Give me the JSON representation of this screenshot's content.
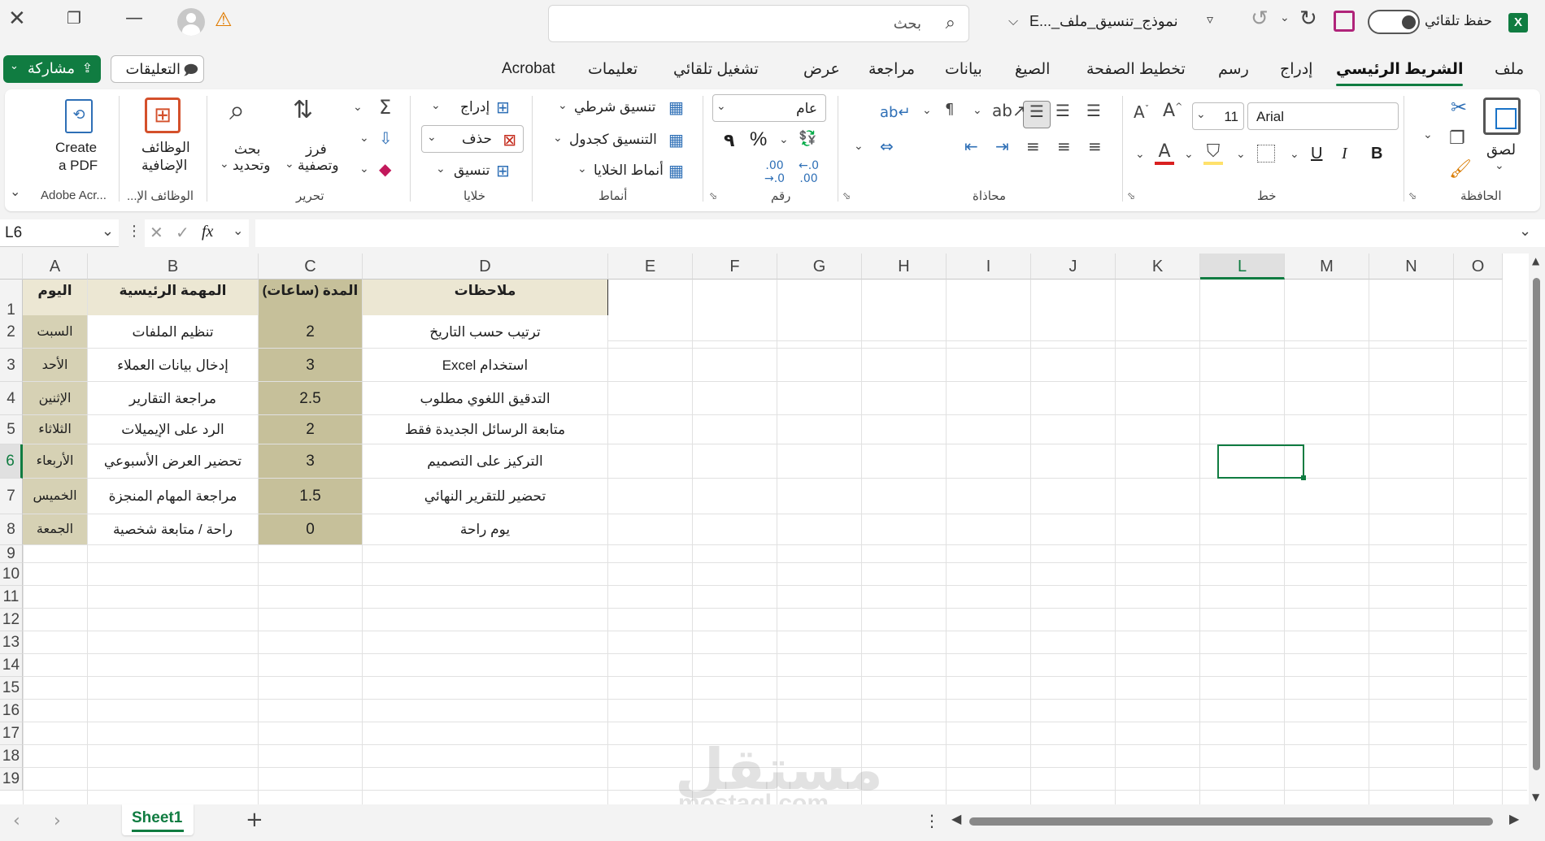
{
  "window": {
    "app_icon": "excel-icon",
    "autosave_label": "حفظ تلقائي",
    "file_name": "نموذج_تنسيق_ملف_...E",
    "search_placeholder": "بحث",
    "warning_icon": "warning-icon"
  },
  "menu": {
    "tabs": [
      "ملف",
      "الشريط الرئيسي",
      "إدراج",
      "رسم",
      "تخطيط الصفحة",
      "الصيغ",
      "بيانات",
      "مراجعة",
      "عرض",
      "تشغيل تلقائي",
      "تعليمات",
      "Acrobat"
    ],
    "active": "الشريط الرئيسي",
    "comments_label": "التعليقات",
    "share_label": "مشاركة"
  },
  "ribbon": {
    "clipboard": {
      "label": "الحافظة",
      "paste": "لصق"
    },
    "font": {
      "label": "خط",
      "name": "Arial",
      "size": "11",
      "bold": "B",
      "italic": "I",
      "underline": "U"
    },
    "alignment": {
      "label": "محاذاة"
    },
    "number": {
      "label": "رقم",
      "format": "عام",
      "percent": "%",
      "comma": "٩"
    },
    "styles": {
      "label": "أنماط",
      "conditional": "تنسيق شرطي",
      "as_table": "التنسيق كجدول",
      "cell_styles": "أنماط الخلايا"
    },
    "cells": {
      "label": "خلايا",
      "insert": "إدراج",
      "delete": "حذف",
      "format": "تنسيق"
    },
    "editing": {
      "label": "تحرير",
      "sort_filter_1": "فرز",
      "sort_filter_2": "وتصفية",
      "find_1": "بحث",
      "find_2": "وتحديد"
    },
    "addins": {
      "label": "الوظائف الإ...",
      "btn_1": "الوظائف",
      "btn_2": "الإضافية"
    },
    "acrobat": {
      "label": "Adobe Acr...",
      "btn_1": "Create",
      "btn_2": "a PDF"
    }
  },
  "formula_bar": {
    "name_box": "L6",
    "fx": "fx",
    "content": ""
  },
  "sheet": {
    "columns": [
      "A",
      "B",
      "C",
      "D",
      "E",
      "F",
      "G",
      "H",
      "I",
      "J",
      "K",
      "L",
      "M",
      "N",
      "O"
    ],
    "rows": [
      "1",
      "2",
      "3",
      "4",
      "5",
      "6",
      "7",
      "8",
      "9",
      "10",
      "11",
      "12",
      "13",
      "14",
      "15",
      "16",
      "17",
      "18",
      "19"
    ],
    "header": [
      "اليوم",
      "المهمة الرئيسية",
      "المدة (ساعات)",
      "ملاحظات"
    ],
    "data": [
      [
        "السبت",
        "تنظيم الملفات",
        "2",
        "ترتيب حسب التاريخ"
      ],
      [
        "الأحد",
        "إدخال بيانات العملاء",
        "3",
        "استخدام Excel"
      ],
      [
        "الإثنين",
        "مراجعة التقارير",
        "2.5",
        "التدقيق اللغوي مطلوب"
      ],
      [
        "الثلاثاء",
        "الرد على الإيميلات",
        "2",
        "متابعة الرسائل الجديدة فقط"
      ],
      [
        "الأربعاء",
        "تحضير العرض الأسبوعي",
        "3",
        "التركيز على التصميم"
      ],
      [
        "الخميس",
        "مراجعة المهام المنجزة",
        "1.5",
        "تحضير للتقرير النهائي"
      ],
      [
        "الجمعة",
        "راحة / متابعة شخصية",
        "0",
        "يوم راحة"
      ]
    ],
    "active_cell": "L6",
    "colors": {
      "header_fill": "#ece7d3",
      "day_fill": "#d6d1b4",
      "duration_fill": "#c6c09a",
      "accent": "#107c41"
    }
  },
  "watermark": {
    "text_ar": "مستقل",
    "text_en": "mostaql.com"
  },
  "statusbar": {
    "sheet_tab": "Sheet1"
  }
}
